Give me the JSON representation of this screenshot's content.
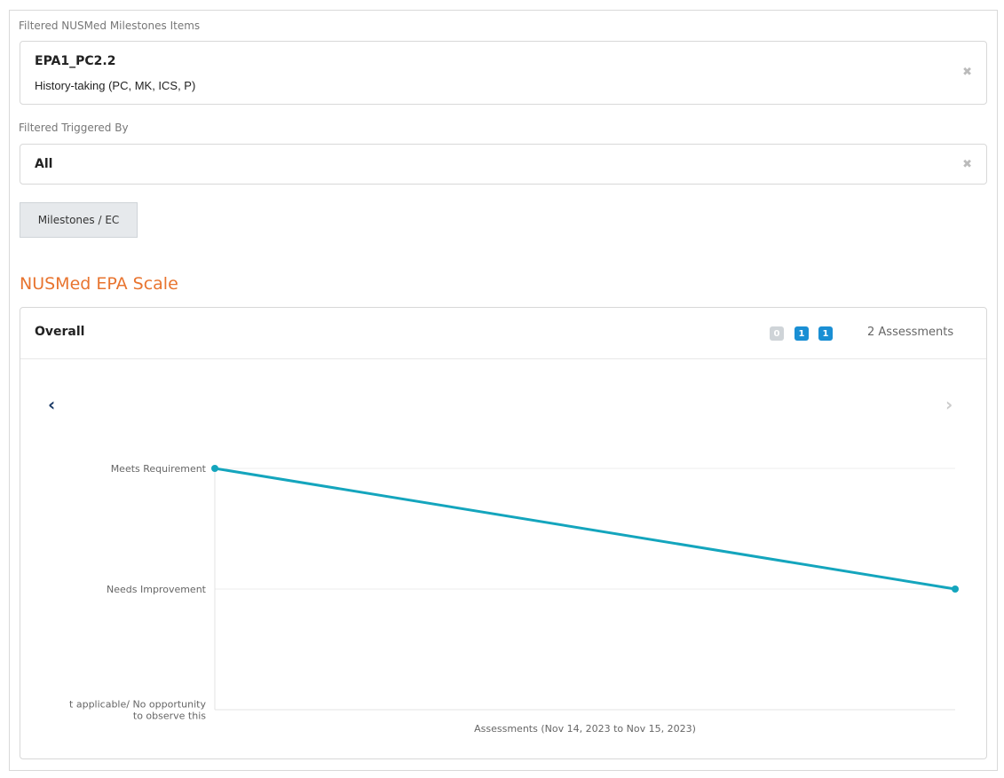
{
  "filters": {
    "milestones": {
      "label": "Filtered NUSMed Milestones Items",
      "title": "EPA1_PC2.2",
      "subtitle": "History-taking (PC, MK, ICS, P)",
      "clear_glyph": "✖"
    },
    "triggered_by": {
      "label": "Filtered Triggered By",
      "value": "All",
      "clear_glyph": "✖"
    }
  },
  "toolbar": {
    "milestones_button": "Milestones / EC"
  },
  "scale": {
    "title": "NUSMed EPA Scale",
    "panel": {
      "title": "Overall",
      "badges": [
        "0",
        "1",
        "1"
      ],
      "assessment_count": "2 Assessments",
      "prev_glyph": "‹",
      "next_glyph": "›"
    }
  },
  "colors": {
    "accent": "#e8742f",
    "line": "#14a5bd",
    "badge_blue": "#1a8fd4",
    "badge_grey": "#cfd4d8"
  },
  "chart_data": {
    "type": "line",
    "levels": [
      "Not applicable/ No opportunity to observe this",
      "Needs Improvement",
      "Meets Requirement"
    ],
    "tick_labels": [
      [
        "t applicable/ No opportunity",
        "to observe this"
      ],
      [
        "Needs Improvement"
      ],
      [
        "Meets Requirement"
      ]
    ],
    "x": [
      "Nov 14, 2023",
      "Nov 15, 2023"
    ],
    "series": [
      {
        "values": [
          "Meets Requirement",
          "Needs Improvement"
        ]
      }
    ],
    "xlabel": "Assessments (Nov 14, 2023 to Nov 15, 2023)",
    "ylabel": "",
    "grid": true
  }
}
